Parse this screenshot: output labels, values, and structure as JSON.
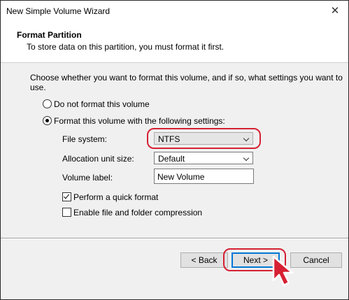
{
  "window": {
    "title": "New Simple Volume Wizard",
    "close_glyph": "✕"
  },
  "header": {
    "title": "Format Partition",
    "subtitle": "To store data on this partition, you must format it first."
  },
  "instruction": "Choose whether you want to format this volume, and if so, what settings you want to use.",
  "options": {
    "no_format_label": "Do not format this volume",
    "no_format_selected": false,
    "format_label": "Format this volume with the following settings:",
    "format_selected": true
  },
  "settings": {
    "file_system_label": "File system:",
    "file_system_value": "NTFS",
    "allocation_label": "Allocation unit size:",
    "allocation_value": "Default",
    "volume_label_label": "Volume label:",
    "volume_label_value": "New Volume",
    "quick_format_label": "Perform a quick format",
    "quick_format_checked": true,
    "compression_label": "Enable file and folder compression",
    "compression_checked": false
  },
  "buttons": {
    "back": "< Back",
    "next": "Next >",
    "cancel": "Cancel"
  },
  "annotations": {
    "highlight_color": "#d62033"
  }
}
